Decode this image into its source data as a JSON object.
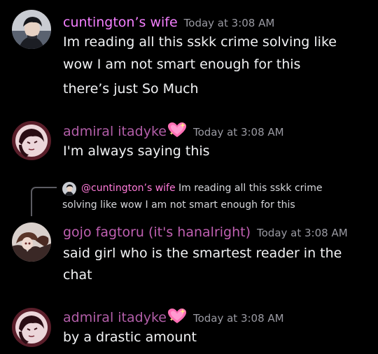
{
  "colors": {
    "background": "#000000",
    "cuntington_name": "#f47fff",
    "itadyke_name": "#b25ea8",
    "gojo_name": "#c060b2",
    "timestamp": "#9a9aa2",
    "message_text": "#f2f3f5",
    "reply_user": "#ff7ad9"
  },
  "messages": [
    {
      "username": "cuntington’s wife",
      "timestamp": "Today at 3:08 AM",
      "avatar_icon": "dark-haired-man-avatar-icon",
      "lines": [
        "Im reading all this sskk crime solving like",
        "wow I am not smart enough for this",
        "there’s just So Much"
      ]
    },
    {
      "username": "admiral itadyke",
      "username_badge": "sparkling-heart-icon",
      "timestamp": "Today at 3:08 AM",
      "avatar_icon": "anime-character-avatar-icon",
      "lines": [
        "I'm always saying this"
      ]
    },
    {
      "reply": {
        "username": "@cuntington’s wife",
        "preview_line1": "Im reading all this sskk crime",
        "preview_line2": "solving like wow I am not smart enough for this"
      },
      "username": "gojo fagtoru (it's hanalright)",
      "timestamp": "Today at 3:08 AM",
      "avatar_icon": "anime-character-avatar-icon",
      "lines": [
        "said girl who is the smartest reader in the",
        "chat"
      ]
    },
    {
      "username": "admiral itadyke",
      "username_badge": "sparkling-heart-icon",
      "timestamp": "Today at 3:08 AM",
      "avatar_icon": "anime-character-avatar-icon",
      "lines": [
        "by a drastic amount"
      ]
    }
  ]
}
